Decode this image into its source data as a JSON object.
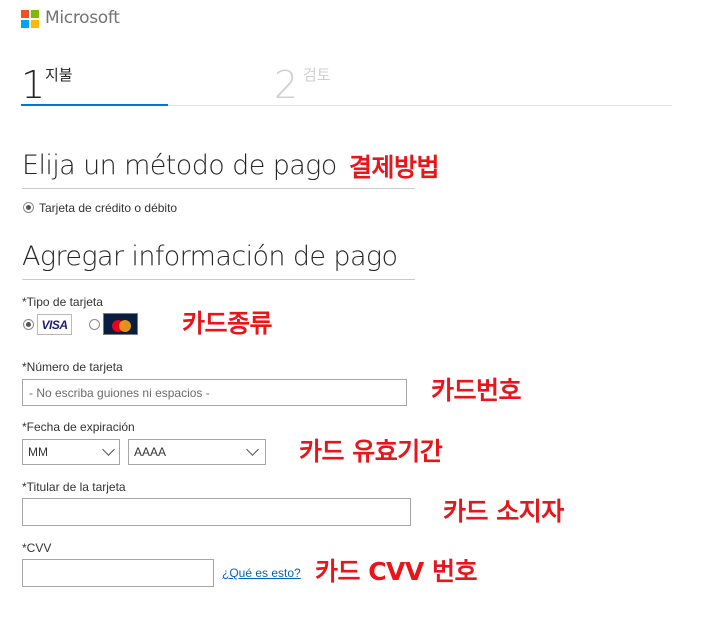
{
  "brand": {
    "name": "Microsoft"
  },
  "steps": [
    {
      "number": "1",
      "label": "지불"
    },
    {
      "number": "2",
      "label": "검토"
    }
  ],
  "payment_method": {
    "heading": "Elija un método de pago",
    "option_label": "Tarjeta de crédito o débito"
  },
  "payment_info": {
    "heading": "Agregar información de pago",
    "card_type_label": "*Tipo de tarjeta",
    "card_types": [
      {
        "name": "VISA"
      },
      {
        "name": "Mastercard"
      }
    ],
    "card_number_label": "*Número de tarjeta",
    "card_number_placeholder": "- No escriba guiones ni espacios -",
    "expiry_label": "*Fecha de expiración",
    "expiry_month": "MM",
    "expiry_year": "AAAA",
    "holder_label": "*Titular de la tarjeta",
    "cvv_label": "*CVV",
    "cvv_help_link": "¿Qué es esto?"
  },
  "annotations": {
    "payment_method": "결제방법",
    "card_type": "카드종류",
    "card_number": "카드번호",
    "expiry": "카드 유효기간",
    "holder": "카드 소지자",
    "cvv": "카드 CVV 번호"
  }
}
